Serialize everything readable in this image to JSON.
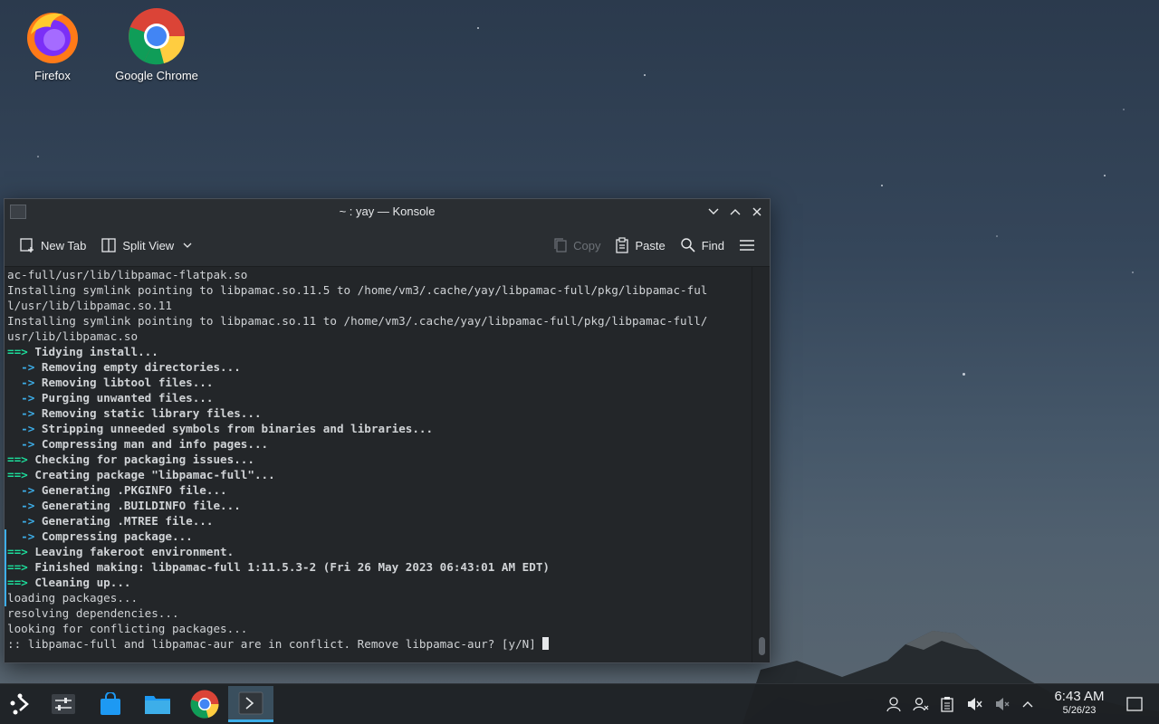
{
  "desktop": {
    "icons": [
      {
        "label": "Firefox",
        "icon": "firefox-icon"
      },
      {
        "label": "Google Chrome",
        "icon": "chrome-icon"
      }
    ]
  },
  "window": {
    "title": "~ : yay — Konsole",
    "toolbar": {
      "new_tab": "New Tab",
      "split_view": "Split View",
      "copy": "Copy",
      "paste": "Paste",
      "find": "Find"
    }
  },
  "terminal": {
    "lines": [
      "ac-full/usr/lib/libpamac-flatpak.so",
      "Installing symlink pointing to libpamac.so.11.5 to /home/vm3/.cache/yay/libpamac-full/pkg/libpamac-ful",
      "l/usr/lib/libpamac.so.11",
      "Installing symlink pointing to libpamac.so.11 to /home/vm3/.cache/yay/libpamac-full/pkg/libpamac-full/",
      "usr/lib/libpamac.so",
      "Tidying install...",
      "Removing empty directories...",
      "Removing libtool files...",
      "Purging unwanted files...",
      "Removing static library files...",
      "Stripping unneeded symbols from binaries and libraries...",
      "Compressing man and info pages...",
      "Checking for packaging issues...",
      "Creating package \"libpamac-full\"...",
      "Generating .PKGINFO file...",
      "Generating .BUILDINFO file...",
      "Generating .MTREE file...",
      "Compressing package...",
      "Leaving fakeroot environment.",
      "Finished making: libpamac-full 1:11.5.3-2 (Fri 26 May 2023 06:43:01 AM EDT)",
      "Cleaning up...",
      "loading packages...",
      "resolving dependencies...",
      "looking for conflicting packages...",
      ":: libpamac-full and libpamac-aur are in conflict. Remove libpamac-aur? [y/N] "
    ],
    "prefix_main": "==> ",
    "prefix_sub": "  -> "
  },
  "taskbar": {
    "time": "6:43 AM",
    "date": "5/26/23"
  },
  "colors": {
    "accent": "#3daee9",
    "prompt_green": "#1cdc9a",
    "terminal_bg": "#232629"
  }
}
